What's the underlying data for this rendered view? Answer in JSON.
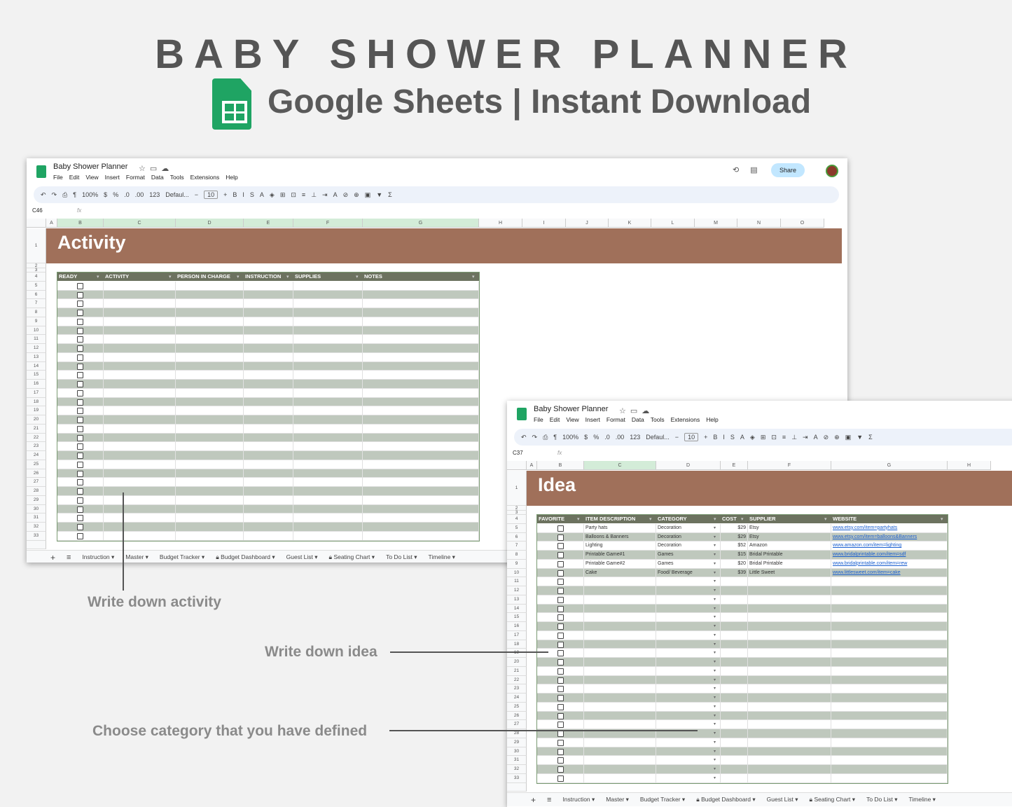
{
  "hero": {
    "title": "BABY SHOWER PLANNER",
    "subtitle": "Google Sheets | Instant Download"
  },
  "app": {
    "doc_title": "Baby Shower Planner",
    "menus": [
      "File",
      "Edit",
      "View",
      "Insert",
      "Format",
      "Data",
      "Tools",
      "Extensions",
      "Help"
    ],
    "share_label": "Share",
    "zoom": "100%",
    "font": "Defaul...",
    "font_size": "10",
    "toolbar_icons": [
      "undo",
      "redo",
      "print",
      "paint-format"
    ],
    "tabs": [
      "Instruction",
      "Master",
      "Budget Tracker",
      "Budget Dashboard",
      "Guest List",
      "Seating Chart",
      "To Do List",
      "Timeline"
    ]
  },
  "activity_sheet": {
    "cell_ref": "C46",
    "columns": [
      "A",
      "B",
      "C",
      "D",
      "E",
      "F",
      "G",
      "H",
      "I",
      "J",
      "K",
      "L",
      "M",
      "N",
      "O"
    ],
    "banner": "Activity",
    "headers": [
      "READY",
      "ACTIVITY",
      "PERSON IN CHARGE",
      "INSTRUCTION",
      "SUPPLIES",
      "NOTES"
    ]
  },
  "idea_sheet": {
    "cell_ref": "C37",
    "columns": [
      "A",
      "B",
      "C",
      "D",
      "E",
      "F",
      "G",
      "H"
    ],
    "banner": "Idea",
    "headers": [
      "FAVORITE",
      "ITEM DESCRIPTION",
      "CATEGORY",
      "COST",
      "SUPPLIER",
      "WEBSITE"
    ],
    "rows": [
      {
        "item": "Party hats",
        "category": "Decoration",
        "cost": "$29",
        "supplier": "Etsy",
        "website": "www.etsy.com/item=partyhats"
      },
      {
        "item": "Balloons & Banners",
        "category": "Decoration",
        "cost": "$29",
        "supplier": "Etsy",
        "website": "www.etsy.com/item=balloons&Banners"
      },
      {
        "item": "Lighting",
        "category": "Decoration",
        "cost": "$52",
        "supplier": "Amazon",
        "website": "www.amazon.com/item=lighting"
      },
      {
        "item": "Printable Game#1",
        "category": "Games",
        "cost": "$15",
        "supplier": "Bridal Printable",
        "website": "www.bridalprintable.com/item=sdf"
      },
      {
        "item": "Printable Game#2",
        "category": "Games",
        "cost": "$20",
        "supplier": "Bridal Printable",
        "website": "www.bridalprintable.com/item=rew"
      },
      {
        "item": "Cake",
        "category": "Food/ Beverage",
        "cost": "$39",
        "supplier": "Little Sweet",
        "website": "www.littlesweet.com/item=cake"
      }
    ]
  },
  "annotations": {
    "activity": "Write down activity",
    "idea": "Write down idea",
    "category": "Choose category that you have defined"
  },
  "colors": {
    "banner": "#a0705a",
    "header": "#6c725f",
    "stripe": "#bfc8bd",
    "accent": "#1fa463"
  }
}
